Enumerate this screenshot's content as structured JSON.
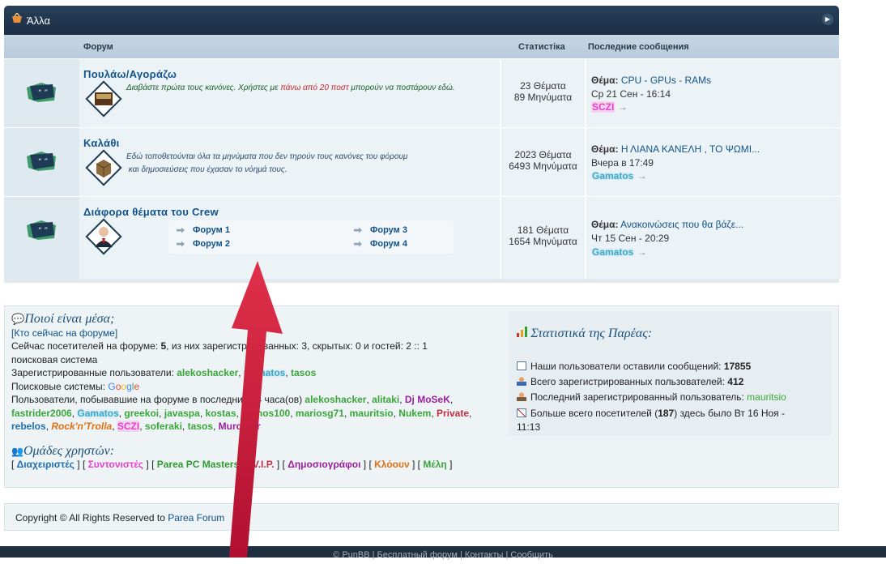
{
  "category": {
    "title": "Άλλα"
  },
  "table_headers": {
    "forum": "Форум",
    "stats": "Статистіка",
    "last": "Последние сообщения"
  },
  "forums": [
    {
      "title": "Πουλάω/Αγοράζω",
      "desc_parts": [
        "Διαβάστε πρώτα τους κανόνες. Χρήστες με ",
        "πάνω από 20 ποστ",
        " μπορούν να ποστάρουν εδώ."
      ],
      "topics": "23 Θέματα",
      "posts": "89 Μηνύματα",
      "last_label": "Θέμα:",
      "last_title": "CPU - GPUs - RAMs",
      "last_date": "Ср 21 Сен - 16:14",
      "last_user": "SCZI",
      "last_user_color": "#e83fd0"
    },
    {
      "title": "Καλάθι",
      "desc_line1": "Εδώ τοποθετούνται όλα τα μηνύματα που δεν τηρούν τους κανόνες του φόρουμ",
      "desc_line2": "και δημοσιεύσεις που έχασαν το νόημά τους.",
      "topics": "2023 Θέματα",
      "posts": "6493 Μηνύματα",
      "last_label": "Θέμα:",
      "last_title": "Η ΛΙΑΝΑ ΚΑΝΕΛΗ , ΤΟ ΨΩΜΙ...",
      "last_date": "Вчера в 17:49",
      "last_user": "Gamatos",
      "last_user_color": "#3fa7c8"
    },
    {
      "title": "Διάφορα θέματα του Crew",
      "subforums": [
        "Форум 1",
        "Форум 2",
        "Форум 3",
        "Форум 4"
      ],
      "topics": "181 Θέματα",
      "posts": "1654 Μηνύματα",
      "last_label": "Θέμα:",
      "last_title": "Ανακοινώσεις που θα βάζε...",
      "last_date": "Чт 15 Сен - 20:29",
      "last_user": "Gamatos",
      "last_user_color": "#3fa7c8"
    }
  ],
  "who": {
    "heading": "Ποιοί είναι μέσα;",
    "link": "[Кто сейчас на форуме]",
    "line1": "Сейчас посетителей на форуме: ",
    "line1_b": "5",
    "line1_rest": ", из них зарегистрированных: 3, скрытых: 0 и гостей: 2 :: 1",
    "line2": "поисковая система",
    "registered_label": "Зарегистрированные пользователи: ",
    "registered_users": [
      {
        "name": "alekoshacker",
        "color": "#3aa63a"
      },
      {
        "name": "Gamatos",
        "color": "#3fa7c8"
      },
      {
        "name": "tasos",
        "color": "#3aa63a"
      }
    ],
    "search_label": "Поисковые системы: ",
    "search_engine": "Google",
    "visited_label": "Пользователи, побывавшие на форуме в последние 24 часа(ов) ",
    "visited_users": [
      {
        "name": "alekoshacker",
        "color": "#3aa63a"
      },
      {
        "name": "alitaki",
        "color": "#3aa63a"
      },
      {
        "name": "Dj MoSeK",
        "color": "#9b1fa0"
      },
      {
        "name": "fastrider2006",
        "color": "#3aa63a"
      },
      {
        "name": "Gamatos",
        "color": "#3fa7c8"
      },
      {
        "name": "greekoi",
        "color": "#3aa63a"
      },
      {
        "name": "javaspa",
        "color": "#3aa63a"
      },
      {
        "name": "kostas",
        "color": "#3aa63a"
      },
      {
        "name": "kronos100",
        "color": "#3aa63a"
      },
      {
        "name": "mariosg71",
        "color": "#3aa63a"
      },
      {
        "name": "mauritsio",
        "color": "#3aa63a"
      },
      {
        "name": "Nukem",
        "color": "#3aa63a"
      },
      {
        "name": "Private",
        "color": "#c0303f"
      },
      {
        "name": "rebelos",
        "color": "#1f6fae"
      },
      {
        "name": "Rock'n'Trolla",
        "color": "#e07010"
      },
      {
        "name": "SCZI",
        "color": "#e83fd0"
      },
      {
        "name": "soferaki",
        "color": "#3aa63a"
      },
      {
        "name": "tasos",
        "color": "#3aa63a"
      },
      {
        "name": "Murderer",
        "color": "#9b1fa0"
      }
    ],
    "groups_heading": "Ομάδες χρηστών:",
    "groups": [
      {
        "name": "Διαχειριστές",
        "color": "#1f6fae"
      },
      {
        "name": "Συντονιστές",
        "color": "#e83fd0"
      },
      {
        "name": "Parea PC Masters",
        "color": "#2f9a2f"
      },
      {
        "name": "V.I.P.",
        "color": "#c0303f"
      },
      {
        "name": "Δημοσιογράφοι",
        "color": "#9b1fa0"
      },
      {
        "name": "Κλόουν",
        "color": "#e07010"
      },
      {
        "name": "Μέλη",
        "color": "#3aa63a"
      }
    ]
  },
  "stats": {
    "heading": "Στατιστικά της Παρέας:",
    "posts_label": "Наши пользователи оставили сообщений: ",
    "posts_value": "17855",
    "users_label": "Всего зарегистрированных пользователей: ",
    "users_value": "412",
    "last_label": "Последний зарегистрированный пользователь: ",
    "last_value": "mauritsio",
    "max_label": "Больше всего посетителей (",
    "max_value": "187",
    "max_rest": ") здесь было Вт 16 Ноя -",
    "max_time": "11:13"
  },
  "copyright": {
    "text": "Copyright © All Rights Reserved to ",
    "link": "Parea Forum"
  },
  "footer": {
    "text": "© PunBB | Бесплатный форум | Контакты | Сообщить"
  }
}
